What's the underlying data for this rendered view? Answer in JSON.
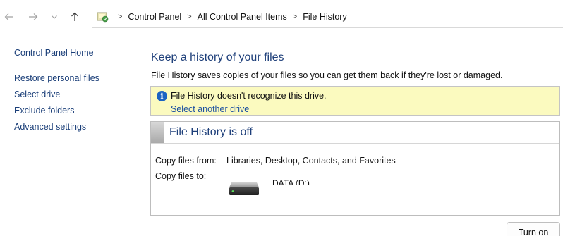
{
  "nav": {
    "back_icon": "arrow-left-icon",
    "forward_icon": "arrow-right-icon",
    "recent_icon": "chevron-down-icon",
    "up_icon": "arrow-up-icon"
  },
  "address": {
    "icon": "control-panel-icon",
    "breadcrumbs": [
      "Control Panel",
      "All Control Panel Items",
      "File History"
    ]
  },
  "sidebar": {
    "home": "Control Panel Home",
    "items": [
      "Restore personal files",
      "Select drive",
      "Exclude folders",
      "Advanced settings"
    ]
  },
  "main": {
    "title": "Keep a history of your files",
    "description": "File History saves copies of your files so you can get them back if they're lost or damaged."
  },
  "info_bar": {
    "icon": "info-icon",
    "message": "File History doesn't recognize this drive.",
    "link": "Select another drive"
  },
  "status_panel": {
    "title": "File History is off",
    "copy_from_label": "Copy files from:",
    "copy_from_value": "Libraries, Desktop, Contacts, and Favorites",
    "copy_to_label": "Copy files to:",
    "drive_icon": "hard-drive-icon",
    "drive_name": "DATA (D:)"
  },
  "actions": {
    "turn_on": "Turn on"
  },
  "colors": {
    "link": "#1a3e78",
    "heading": "#1e3f7a",
    "info_background": "#fbfabf",
    "info_icon": "#1b63c2"
  }
}
